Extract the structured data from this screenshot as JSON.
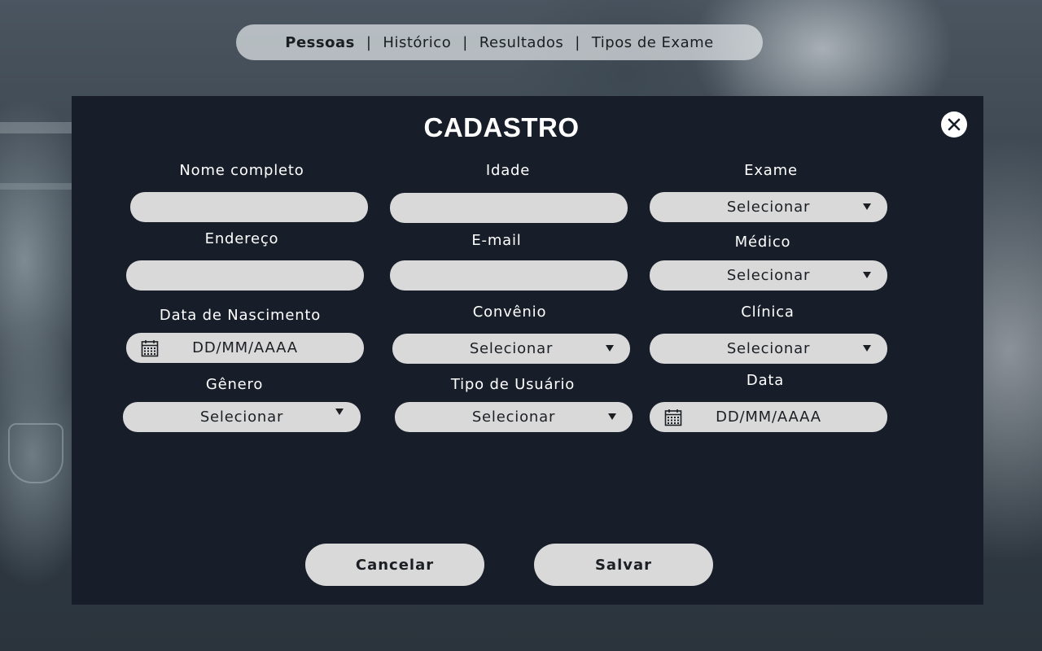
{
  "nav": {
    "items": [
      {
        "label": "Pessoas",
        "active": true
      },
      {
        "label": "Histórico",
        "active": false
      },
      {
        "label": "Resultados",
        "active": false
      },
      {
        "label": "Tipos de Exame",
        "active": false
      }
    ],
    "separator": "|"
  },
  "modal": {
    "title": "CADASTRO",
    "close_icon": "close-icon"
  },
  "form": {
    "nome_completo": {
      "label": "Nome completo",
      "value": ""
    },
    "idade": {
      "label": "Idade",
      "value": ""
    },
    "exame": {
      "label": "Exame",
      "value": "Selecionar"
    },
    "endereco": {
      "label": "Endereço",
      "value": ""
    },
    "email": {
      "label": "E-mail",
      "value": ""
    },
    "medico": {
      "label": "Médico",
      "value": "Selecionar"
    },
    "data_nascimento": {
      "label": "Data de Nascimento",
      "placeholder": "DD/MM/AAAA"
    },
    "convenio": {
      "label": "Convênio",
      "value": "Selecionar"
    },
    "clinica": {
      "label": "Clínica",
      "value": "Selecionar"
    },
    "genero": {
      "label": "Gênero",
      "value": "Selecionar"
    },
    "tipo_usuario": {
      "label": "Tipo de Usuário",
      "value": "Selecionar"
    },
    "data": {
      "label": "Data",
      "placeholder": "DD/MM/AAAA"
    }
  },
  "actions": {
    "cancel_label": "Cancelar",
    "save_label": "Salvar"
  },
  "colors": {
    "modal_bg": "#171e29",
    "field_bg": "#d9d9d9",
    "text_dark": "#1b1f24",
    "text_light": "#ffffff"
  }
}
